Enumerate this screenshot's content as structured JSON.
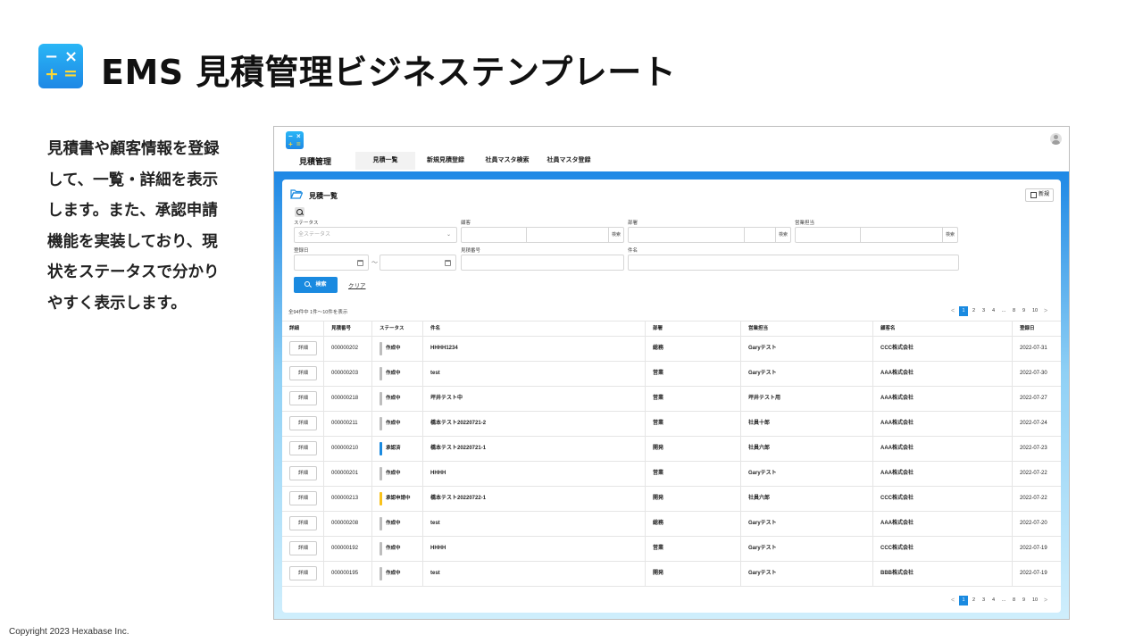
{
  "slide": {
    "title": "EMS 見積管理ビジネステンプレート",
    "description_lines": [
      "見積書や顧客情報を登録",
      "して、一覧・詳細を表示",
      "します。また、承認申請",
      "機能を実装しており、現",
      "状をステータスで分かり",
      "やすく表示します。"
    ],
    "copyright": "Copyright 2023 Hexabase Inc."
  },
  "app": {
    "name": "見積管理",
    "tabs": [
      {
        "label": "見積一覧",
        "active": true
      },
      {
        "label": "新規見積登録",
        "active": false
      },
      {
        "label": "社員マスタ検索",
        "active": false
      },
      {
        "label": "社員マスタ登録",
        "active": false
      }
    ],
    "panel_title": "見積一覧",
    "new_button": "新規",
    "search": {
      "status_label": "ステータス",
      "status_placeholder": "全ステータス",
      "customer_label": "顧客",
      "department_label": "部署",
      "sales_label": "営業担当",
      "search_inline": "検索",
      "date_label": "登録日",
      "date_sep": "〜",
      "estimate_no_label": "見積番号",
      "subject_label": "件名",
      "search_button": "検索",
      "clear_link": "クリア"
    },
    "result_count": "全94件中 1件〜10件を表示",
    "pagination": {
      "prev": "<",
      "pages": [
        "1",
        "2",
        "3",
        "4"
      ],
      "ellipsis": "...",
      "tail_pages": [
        "8",
        "9",
        "10"
      ],
      "next": ">",
      "active_page": "1"
    },
    "table": {
      "headers": [
        "詳細",
        "見積番号",
        "ステータス",
        "件名",
        "部署",
        "営業担当",
        "顧客名",
        "登録日"
      ],
      "detail_label": "詳細",
      "status_colors": {
        "作成中": "#bdbdbd",
        "承認済": "#1a8ae0",
        "承認申請中": "#f9c21a"
      },
      "rows": [
        {
          "no": "000000202",
          "status": "作成中",
          "subject": "HHHH1234",
          "dept": "総務",
          "sales": "Garyテスト",
          "customer": "CCC株式会社",
          "date": "2022-07-31"
        },
        {
          "no": "000000203",
          "status": "作成中",
          "subject": "test",
          "dept": "営業",
          "sales": "Garyテスト",
          "customer": "AAA株式会社",
          "date": "2022-07-30"
        },
        {
          "no": "000000218",
          "status": "作成中",
          "subject": "坪井テスト中",
          "dept": "営業",
          "sales": "坪井テスト用",
          "customer": "AAA株式会社",
          "date": "2022-07-27"
        },
        {
          "no": "000000211",
          "status": "作成中",
          "subject": "橋本テスト20220721-2",
          "dept": "営業",
          "sales": "社員十郎",
          "customer": "AAA株式会社",
          "date": "2022-07-24"
        },
        {
          "no": "000000210",
          "status": "承認済",
          "subject": "橋本テスト20220721-1",
          "dept": "開発",
          "sales": "社員六郎",
          "customer": "AAA株式会社",
          "date": "2022-07-23"
        },
        {
          "no": "000000201",
          "status": "作成中",
          "subject": "HHHH",
          "dept": "営業",
          "sales": "Garyテスト",
          "customer": "AAA株式会社",
          "date": "2022-07-22"
        },
        {
          "no": "000000213",
          "status": "承認申請中",
          "subject": "橋本テスト20220722-1",
          "dept": "開発",
          "sales": "社員六郎",
          "customer": "CCC株式会社",
          "date": "2022-07-22"
        },
        {
          "no": "000000208",
          "status": "作成中",
          "subject": "test",
          "dept": "総務",
          "sales": "Garyテスト",
          "customer": "AAA株式会社",
          "date": "2022-07-20"
        },
        {
          "no": "000000192",
          "status": "作成中",
          "subject": "HHHH",
          "dept": "営業",
          "sales": "Garyテスト",
          "customer": "CCC株式会社",
          "date": "2022-07-19"
        },
        {
          "no": "000000195",
          "status": "作成中",
          "subject": "test",
          "dept": "開発",
          "sales": "Garyテスト",
          "customer": "BBB株式会社",
          "date": "2022-07-19"
        }
      ]
    }
  }
}
